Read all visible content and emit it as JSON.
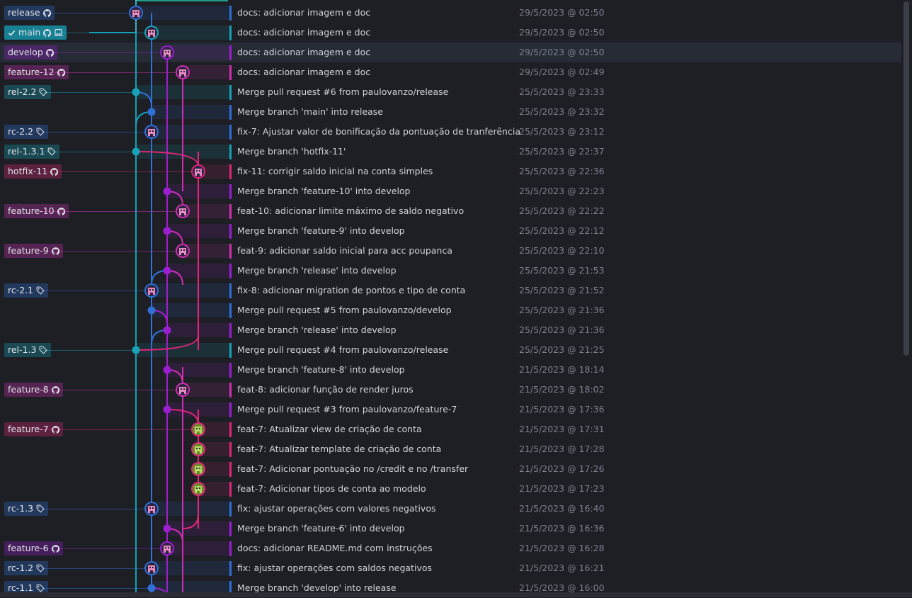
{
  "colors": {
    "release": "#4a7fd8",
    "main": "#16a0b8",
    "develop": "#a01ecb",
    "feature": "#d72e9d",
    "hotfix": "#e0257a"
  },
  "icons": {
    "github": "github-icon",
    "tag": "tag-icon",
    "check": "check-icon",
    "laptop": "laptop-icon"
  },
  "commits": [
    {
      "message": "docs: adicionar imagem e doc",
      "date": "29/5/2023 @ 02:50",
      "ref": "release",
      "ref_icon": "github",
      "color": "#2f6fd6"
    },
    {
      "message": "docs: adicionar imagem e doc",
      "date": "29/5/2023 @ 02:50",
      "ref": "main",
      "ref_icon": "github",
      "ref_current": true,
      "color": "#17a2b8"
    },
    {
      "message": "docs: adicionar imagem e doc",
      "date": "29/5/2023 @ 02:50",
      "ref": "develop",
      "ref_icon": "github",
      "color": "#9b1fd0",
      "selected": true
    },
    {
      "message": "docs: adicionar imagem e doc",
      "date": "29/5/2023 @ 02:49",
      "ref": "feature-12",
      "ref_icon": "github",
      "color": "#d12fb3"
    },
    {
      "message": "Merge pull request #6 from paulovanzo/release",
      "date": "25/5/2023 @ 23:33",
      "ref": "rel-2.2",
      "ref_icon": "tag",
      "color": "#17a2b8"
    },
    {
      "message": "Merge branch 'main' into release",
      "date": "25/5/2023 @ 23:32",
      "ref": "",
      "ref_icon": "",
      "color": "#2f6fd6"
    },
    {
      "message": "fix-7: Ajustar valor de bonificação da pontuação de tranferência",
      "date": "25/5/2023 @ 23:12",
      "ref": "rc-2.2",
      "ref_icon": "tag",
      "color": "#2f6fd6"
    },
    {
      "message": "Merge branch 'hotfix-11'",
      "date": "25/5/2023 @ 22:37",
      "ref": "rel-1.3.1",
      "ref_icon": "tag",
      "color": "#17a2b8"
    },
    {
      "message": "fix-11: corrigir saldo inicial na conta simples",
      "date": "25/5/2023 @ 22:36",
      "ref": "hotfix-11",
      "ref_icon": "github",
      "color": "#e0257a"
    },
    {
      "message": "Merge branch 'feature-10' into develop",
      "date": "25/5/2023 @ 22:23",
      "ref": "",
      "ref_icon": "",
      "color": "#9b1fd0"
    },
    {
      "message": "feat-10: adicionar limite máximo de saldo negativo",
      "date": "25/5/2023 @ 22:22",
      "ref": "feature-10",
      "ref_icon": "github",
      "color": "#d12fb3"
    },
    {
      "message": "Merge branch 'feature-9' into develop",
      "date": "25/5/2023 @ 22:12",
      "ref": "",
      "ref_icon": "",
      "color": "#9b1fd0"
    },
    {
      "message": "feat-9: adicionar saldo inicial para acc poupanca",
      "date": "25/5/2023 @ 22:10",
      "ref": "feature-9",
      "ref_icon": "github",
      "color": "#d12fb3"
    },
    {
      "message": "Merge branch 'release' into develop",
      "date": "25/5/2023 @ 21:53",
      "ref": "",
      "ref_icon": "",
      "color": "#9b1fd0"
    },
    {
      "message": "fix-8: adicionar migration de pontos e tipo de conta",
      "date": "25/5/2023 @ 21:52",
      "ref": "rc-2.1",
      "ref_icon": "tag",
      "color": "#2f6fd6"
    },
    {
      "message": "Merge pull request #5 from paulovanzo/develop",
      "date": "25/5/2023 @ 21:36",
      "ref": "",
      "ref_icon": "",
      "color": "#2f6fd6"
    },
    {
      "message": "Merge branch 'release' into develop",
      "date": "25/5/2023 @ 21:36",
      "ref": "",
      "ref_icon": "",
      "color": "#9b1fd0"
    },
    {
      "message": "Merge pull request #4 from paulovanzo/release",
      "date": "25/5/2023 @ 21:25",
      "ref": "rel-1.3",
      "ref_icon": "tag",
      "color": "#17a2b8"
    },
    {
      "message": "Merge branch 'feature-8' into develop",
      "date": "21/5/2023 @ 18:14",
      "ref": "",
      "ref_icon": "",
      "color": "#9b1fd0"
    },
    {
      "message": "feat-8: adicionar função de render juros",
      "date": "21/5/2023 @ 18:02",
      "ref": "feature-8",
      "ref_icon": "github",
      "color": "#d12fb3"
    },
    {
      "message": "Merge pull request #3 from paulovanzo/feature-7",
      "date": "21/5/2023 @ 17:36",
      "ref": "",
      "ref_icon": "",
      "color": "#9b1fd0"
    },
    {
      "message": "feat-7: Atualizar view de criação de conta",
      "date": "21/5/2023 @ 17:31",
      "ref": "feature-7",
      "ref_icon": "github",
      "color": "#e0257a"
    },
    {
      "message": "feat-7: Atualizar template de criação de conta",
      "date": "21/5/2023 @ 17:28",
      "ref": "",
      "ref_icon": "",
      "color": "#e0257a"
    },
    {
      "message": "feat-7: Adicionar pontuação no /credit e no /transfer",
      "date": "21/5/2023 @ 17:26",
      "ref": "",
      "ref_icon": "",
      "color": "#e0257a"
    },
    {
      "message": "feat-7: Adicionar tipos de conta ao modelo",
      "date": "21/5/2023 @ 17:23",
      "ref": "",
      "ref_icon": "",
      "color": "#e0257a"
    },
    {
      "message": "fix: ajustar operações com valores negativos",
      "date": "21/5/2023 @ 16:40",
      "ref": "rc-1.3",
      "ref_icon": "tag",
      "color": "#2f6fd6"
    },
    {
      "message": "Merge branch 'feature-6' into develop",
      "date": "21/5/2023 @ 16:36",
      "ref": "",
      "ref_icon": "",
      "color": "#9b1fd0"
    },
    {
      "message": "docs: adicionar README.md com instruções",
      "date": "21/5/2023 @ 16:28",
      "ref": "feature-6",
      "ref_icon": "github",
      "color": "#9b1fd0"
    },
    {
      "message": "fix: ajustar operações com saldos negativos",
      "date": "21/5/2023 @ 16:21",
      "ref": "rc-1.2",
      "ref_icon": "tag",
      "color": "#2f6fd6"
    },
    {
      "message": "Merge branch 'develop' into release",
      "date": "21/5/2023 @ 16:00",
      "ref": "rc-1.1",
      "ref_icon": "tag",
      "color": "#2f6fd6"
    }
  ]
}
